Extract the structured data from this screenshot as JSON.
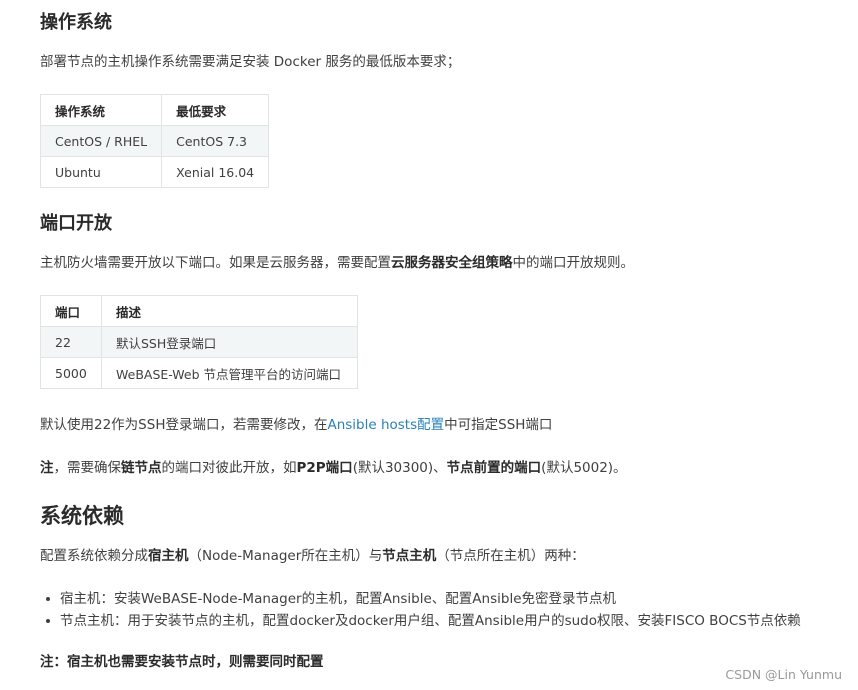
{
  "os_section": {
    "heading": "操作系统",
    "intro": "部署节点的主机操作系统需要满足安装 Docker 服务的最低版本要求；",
    "table": {
      "headers": [
        "操作系统",
        "最低要求"
      ],
      "rows": [
        [
          "CentOS / RHEL",
          "CentOS 7.3"
        ],
        [
          "Ubuntu",
          "Xenial 16.04"
        ]
      ]
    }
  },
  "port_section": {
    "heading": "端口开放",
    "intro_prefix": "主机防火墙需要开放以下端口。如果是云服务器，需要配置",
    "intro_bold": "云服务器安全组策略",
    "intro_suffix": "中的端口开放规则。",
    "table": {
      "headers": [
        "端口",
        "描述"
      ],
      "rows": [
        [
          "22",
          "默认SSH登录端口"
        ],
        [
          "5000",
          "WeBASE-Web 节点管理平台的访问端口"
        ]
      ]
    },
    "ssh_note_prefix": "默认使用22作为SSH登录端口，若需要修改，在",
    "ssh_note_link": "Ansible hosts配置",
    "ssh_note_suffix": "中可指定SSH端口",
    "note_label": "注",
    "note_text1": "，需要确保",
    "note_bold1": "链节点",
    "note_text2": "的端口对彼此开放，如",
    "note_bold2": "P2P端口",
    "note_text3": "(默认30300)、",
    "note_bold3": "节点前置的端口",
    "note_text4": "(默认5002)。"
  },
  "deps_section": {
    "heading": "系统依赖",
    "intro_prefix": "配置系统依赖分成",
    "intro_bold1": "宿主机",
    "intro_mid": "（Node-Manager所在主机）与",
    "intro_bold2": "节点主机",
    "intro_suffix": "（节点所在主机）两种：",
    "items": [
      "宿主机：安装WeBASE-Node-Manager的主机，配置Ansible、配置Ansible免密登录节点机",
      "节点主机：用于安装节点的主机，配置docker及docker用户组、配置Ansible用户的sudo权限、安装FISCO BOCS节点依赖"
    ],
    "note": "注：宿主机也需要安装节点时，则需要同时配置"
  },
  "watermark": "CSDN @Lin Yunmu"
}
